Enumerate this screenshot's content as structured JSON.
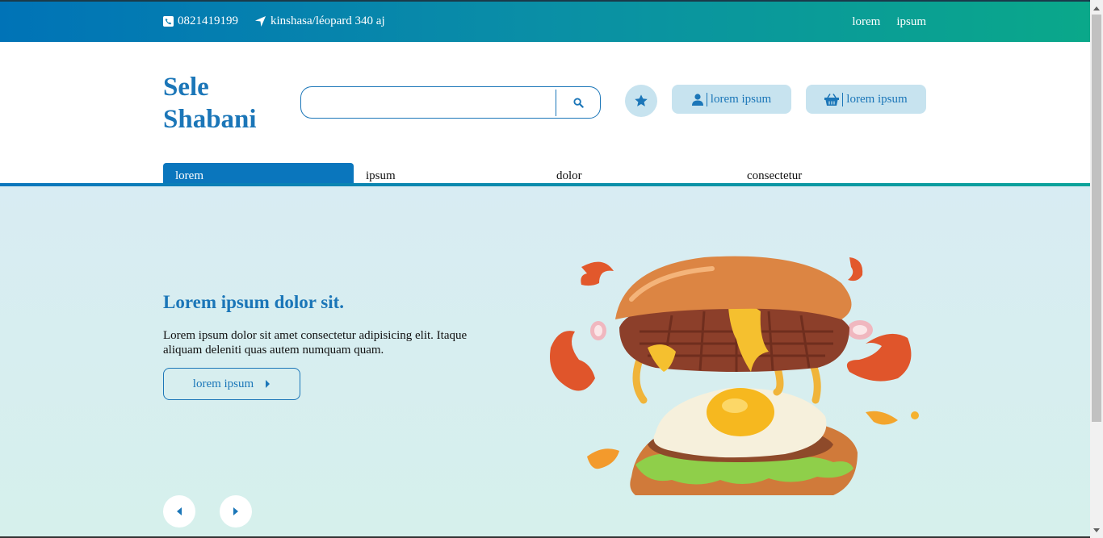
{
  "topbar": {
    "phone": "0821419199",
    "address": "kinshasa/léopard 340 aj",
    "links": [
      "lorem",
      "ipsum"
    ]
  },
  "header": {
    "brand": "Sele Shabani",
    "search_placeholder": "",
    "account_label": "lorem ipsum",
    "cart_label": "lorem ipsum"
  },
  "nav": {
    "tabs": [
      "lorem",
      "ipsum",
      "dolor",
      "consectetur"
    ],
    "active": "lorem"
  },
  "hero": {
    "title": "Lorem ipsum dolor sit.",
    "text": "Lorem ipsum dolor sit amet consectetur adipisicing elit. Itaque aliquam deleniti quas autem numquam quam.",
    "cta_label": "lorem ipsum"
  },
  "colors": {
    "primary": "#1b76b8",
    "accent": "#0aa88a",
    "pill_bg": "#c7e3ef",
    "hero_bg": "#d8ecf3"
  },
  "icons": [
    "phone-icon",
    "location-arrow-icon",
    "search-icon",
    "star-icon",
    "user-icon",
    "basket-icon",
    "caret-right-icon",
    "caret-left-icon"
  ]
}
